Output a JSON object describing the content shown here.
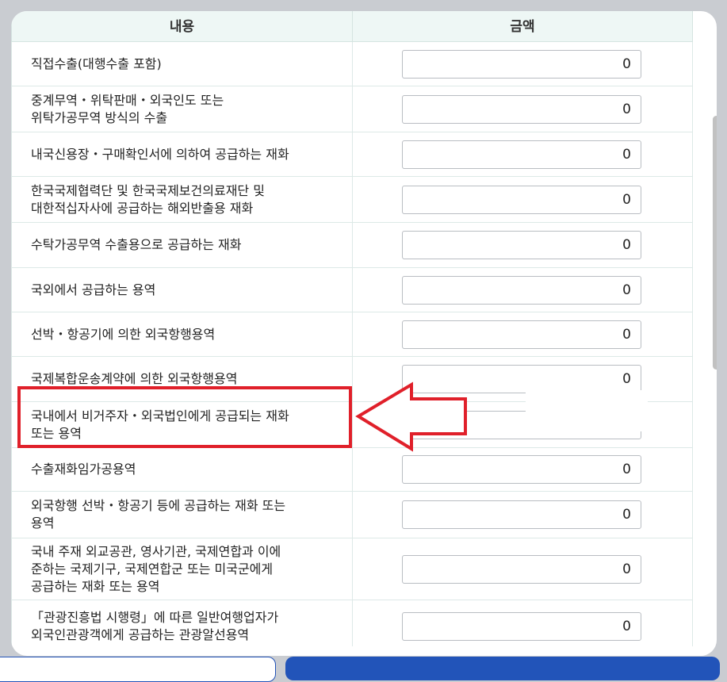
{
  "table": {
    "header": {
      "content": "내용",
      "amount": "금액"
    },
    "rows": [
      {
        "label": "직접수출(대행수출 포함)",
        "value": "0"
      },
      {
        "label": "중계무역・위탁판매・외국인도 또는\n위탁가공무역 방식의 수출",
        "value": "0"
      },
      {
        "label": "내국신용장・구매확인서에 의하여 공급하는 재화",
        "value": "0"
      },
      {
        "label": "한국국제협력단 및 한국국제보건의료재단 및\n대한적십자사에 공급하는 해외반출용 재화",
        "value": "0"
      },
      {
        "label": "수탁가공무역 수출용으로 공급하는 재화",
        "value": "0"
      },
      {
        "label": "국외에서 공급하는 용역",
        "value": "0"
      },
      {
        "label": "선박・항공기에 의한 외국항행용역",
        "value": "0"
      },
      {
        "label": "국제복합운송계약에 의한 외국항행용역",
        "value": "0"
      },
      {
        "label": "국내에서 비거주자・외국법인에게 공급되는 재화\n또는 용역",
        "value": ""
      },
      {
        "label": "수출재화임가공용역",
        "value": "0"
      },
      {
        "label": "외국항행 선박・항공기 등에 공급하는 재화 또는\n용역",
        "value": "0"
      },
      {
        "label": "국내 주재 외교공관, 영사기관, 국제연합과 이에\n준하는 국제기구, 국제연합군 또는 미국군에게\n공급하는 재화 또는 용역",
        "value": "0"
      },
      {
        "label": "「관광진흥법 시행령」에 따른 일반여행업자가\n외국인관광객에게 공급하는 관광알선용역",
        "value": "0"
      }
    ]
  },
  "annotation": {
    "color": "#e0202a",
    "highlighted_row": 8
  },
  "colors": {
    "header_bg": "#eef7f5",
    "primary_button": "#2254b9"
  }
}
